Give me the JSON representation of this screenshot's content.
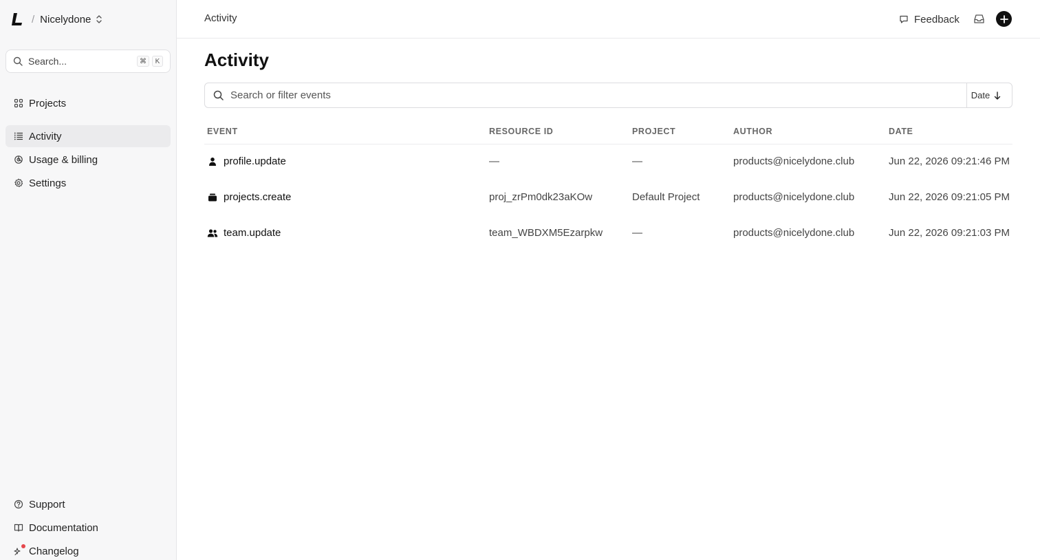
{
  "org": {
    "name": "Nicelydone",
    "separator": "/"
  },
  "sidebar": {
    "search": {
      "placeholder": "Search...",
      "shortcut_cmd": "⌘",
      "shortcut_key": "K"
    },
    "nav": [
      {
        "label": "Projects",
        "icon": "grid-icon"
      },
      {
        "label": "Activity",
        "icon": "list-icon",
        "active": true
      },
      {
        "label": "Usage & billing",
        "icon": "usage-icon"
      },
      {
        "label": "Settings",
        "icon": "gear-icon"
      }
    ],
    "bottom": [
      {
        "label": "Support",
        "icon": "help-icon"
      },
      {
        "label": "Documentation",
        "icon": "book-icon"
      },
      {
        "label": "Changelog",
        "icon": "sparkle-icon"
      }
    ]
  },
  "topbar": {
    "breadcrumb": "Activity",
    "feedback": "Feedback"
  },
  "main": {
    "title": "Activity",
    "filter_placeholder": "Search or filter events",
    "sort_label": "Date",
    "columns": [
      "EVENT",
      "RESOURCE ID",
      "PROJECT",
      "AUTHOR",
      "DATE"
    ],
    "rows": [
      {
        "event": "profile.update",
        "icon": "user-icon",
        "resource_id": "—",
        "project": "—",
        "author": "products@nicelydone.club",
        "date": "Jun 22, 2026 09:21:46 PM"
      },
      {
        "event": "projects.create",
        "icon": "folder-icon",
        "resource_id": "proj_zrPm0dk23aKOw",
        "project": "Default Project",
        "author": "products@nicelydone.club",
        "date": "Jun 22, 2026 09:21:05 PM"
      },
      {
        "event": "team.update",
        "icon": "team-icon",
        "resource_id": "team_WBDXM5Ezarpkw",
        "project": "—",
        "author": "products@nicelydone.club",
        "date": "Jun 22, 2026 09:21:03 PM"
      }
    ]
  }
}
